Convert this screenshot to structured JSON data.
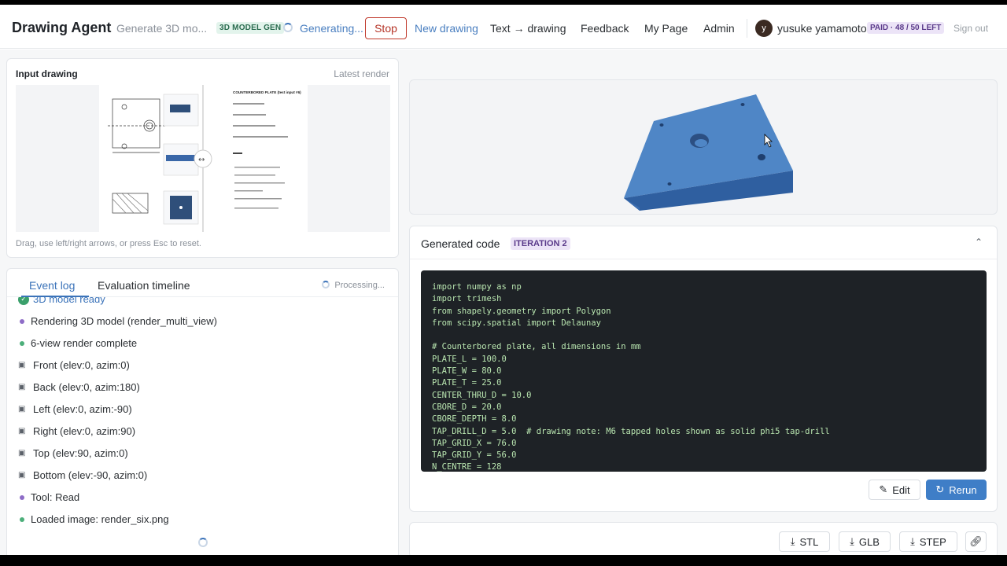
{
  "header": {
    "brand": "Drawing Agent",
    "subtitle": "Generate 3D mo...",
    "mode_badge": "3D MODEL GEN",
    "status": "Generating...",
    "stop_label": "Stop",
    "nav": [
      "New drawing",
      "Text → drawing",
      "Feedback",
      "My Page",
      "Admin"
    ],
    "avatar_initial": "y",
    "username": "yusuke yamamoto",
    "plan_badge": "PAID · 48 / 50 LEFT",
    "signout": "Sign out"
  },
  "input_drawing": {
    "title": "Input drawing",
    "latest_label": "Latest render",
    "hint": "Drag, use left/right arrows, or press Esc to reset.",
    "sheet_title": "COUNTERBORED PLATE (test input #6)"
  },
  "log": {
    "tabs": [
      "Event log",
      "Evaluation timeline"
    ],
    "status": "Processing...",
    "items": [
      {
        "kind": "check",
        "text": "3D model ready"
      },
      {
        "kind": "purple",
        "text": "Rendering 3D model (render_multi_view)"
      },
      {
        "kind": "green",
        "text": "6-view render complete"
      },
      {
        "kind": "cam",
        "text": "Front (elev:0, azim:0)"
      },
      {
        "kind": "cam",
        "text": "Back (elev:0, azim:180)"
      },
      {
        "kind": "cam",
        "text": "Left (elev:0, azim:-90)"
      },
      {
        "kind": "cam",
        "text": "Right (elev:0, azim:90)"
      },
      {
        "kind": "cam",
        "text": "Top (elev:90, azim:0)"
      },
      {
        "kind": "cam",
        "text": "Bottom (elev:-90, azim:0)"
      },
      {
        "kind": "purple",
        "text": "Tool: Read"
      },
      {
        "kind": "green",
        "text": "Loaded image: render_six.png"
      }
    ]
  },
  "code": {
    "title": "Generated code",
    "iteration": "ITERATION 2",
    "lines": [
      "import numpy as np",
      "import trimesh",
      "from shapely.geometry import Polygon",
      "from scipy.spatial import Delaunay",
      "",
      "# Counterbored plate, all dimensions in mm",
      "PLATE_L = 100.0",
      "PLATE_W = 80.0",
      "PLATE_T = 25.0",
      "CENTER_THRU_D = 10.0",
      "CBORE_D = 20.0",
      "CBORE_DEPTH = 8.0",
      "TAP_DRILL_D = 5.0  # drawing note: M6 tapped holes shown as solid phi5 tap-drill",
      "TAP_GRID_X = 76.0",
      "TAP_GRID_Y = 56.0",
      "N_CENTRE = 128"
    ],
    "edit_label": "Edit",
    "rerun_label": "Rerun"
  },
  "downloads": [
    "STL",
    "GLB",
    "STEP"
  ],
  "colors": {
    "accent": "#3f7ec7",
    "stop": "#c0392b",
    "model": "#4f86c6"
  }
}
